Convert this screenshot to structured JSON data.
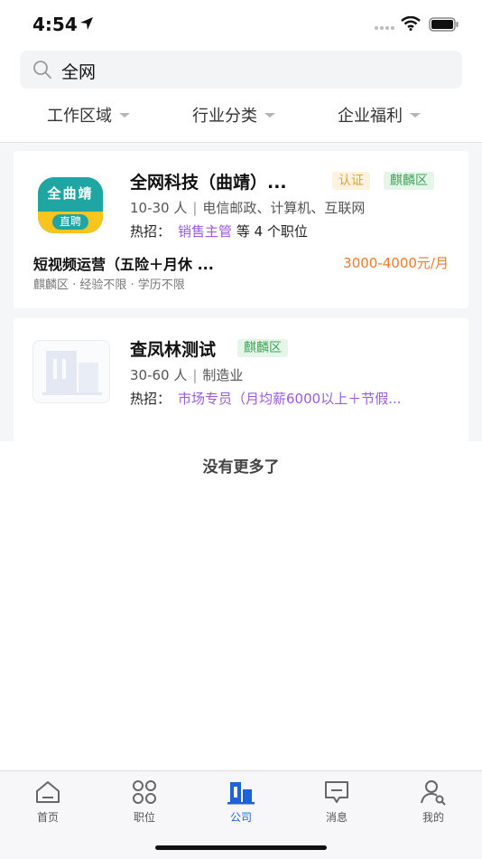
{
  "status_bar": {
    "time": "4:54"
  },
  "search": {
    "query": "全网"
  },
  "filters": [
    {
      "label": "工作区域"
    },
    {
      "label": "行业分类"
    },
    {
      "label": "企业福利"
    }
  ],
  "companies": [
    {
      "logo_top": "全曲靖",
      "logo_bottom": "直聘",
      "name": "全网科技（曲靖）...",
      "cert_tag": "认证",
      "area_tag": "麒麟区",
      "size": "10-30 人",
      "industry": "电信邮政、计算机、互联网",
      "hot_label": "热招：",
      "hot_job": "销售主管",
      "hot_suffix": "等 4 个职位",
      "job": {
        "title": "短视频运营（五险＋月休 ...",
        "salary": "3000-4000元/月",
        "detail": "麒麟区 · 经验不限 · 学历不限"
      }
    },
    {
      "name": "查凤林测试",
      "area_tag": "麒麟区",
      "size": "30-60 人",
      "industry": "制造业",
      "hot_label": "热招：",
      "hot_job": "市场专员（月均薪6000以上＋节假..."
    }
  ],
  "list_end": "没有更多了",
  "tabbar": [
    {
      "label": "首页",
      "icon": "home-icon"
    },
    {
      "label": "职位",
      "icon": "grid-icon"
    },
    {
      "label": "公司",
      "icon": "building-icon",
      "active": true
    },
    {
      "label": "消息",
      "icon": "message-icon"
    },
    {
      "label": "我的",
      "icon": "profile-icon"
    }
  ],
  "colors": {
    "accent": "#1e63d6",
    "salary": "#ee7a2a",
    "hot_link": "#9a5be0",
    "cert": "#e0a43a",
    "area": "#3ea45a"
  }
}
